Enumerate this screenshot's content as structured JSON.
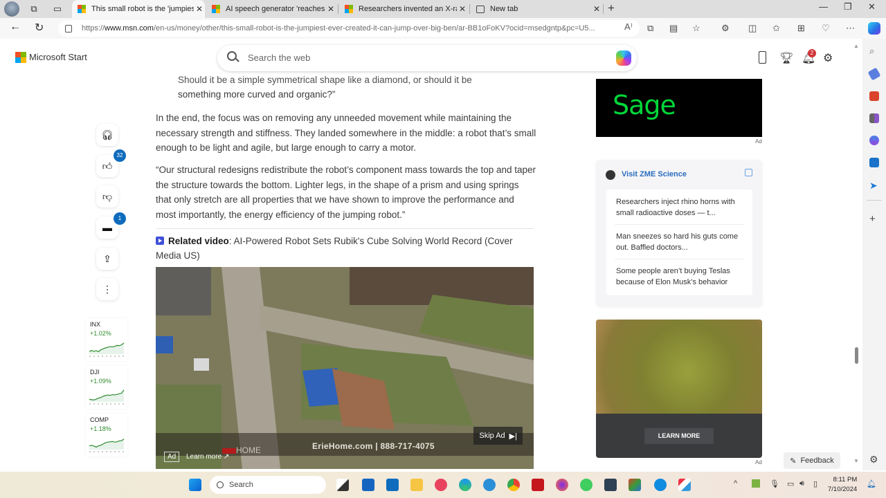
{
  "browser": {
    "tabs": [
      {
        "title": "This small robot is the 'jumpiest'",
        "active": true
      },
      {
        "title": "AI speech generator 'reaches hu",
        "active": false
      },
      {
        "title": "Researchers invented an X-ray vi",
        "active": false
      },
      {
        "title": "New tab",
        "active": false
      }
    ],
    "url_prefix": "https://",
    "url_host": "www.msn.com",
    "url_path": "/en-us/money/other/this-small-robot-is-the-jumpiest-ever-created-it-can-jump-over-big-ben/ar-BB1oFoKV?ocid=msedgntp&pc=U5...",
    "read_aloud_icon": "A⁾"
  },
  "msn": {
    "brand": "Microsoft Start",
    "search_placeholder": "Search the web",
    "notification_count": "2"
  },
  "rail": {
    "like_count": "32",
    "comment_count": "1"
  },
  "tickers": [
    {
      "symbol": "INX",
      "change": "+1.02%",
      "trend": [
        0.2,
        0.3,
        0.22,
        0.28,
        0.2,
        0.35,
        0.42,
        0.5,
        0.55,
        0.6,
        0.58,
        0.62,
        0.7,
        0.68,
        0.75,
        0.9
      ]
    },
    {
      "symbol": "DJI",
      "change": "+1.09%",
      "trend": [
        0.2,
        0.18,
        0.15,
        0.22,
        0.3,
        0.35,
        0.45,
        0.5,
        0.55,
        0.52,
        0.58,
        0.56,
        0.6,
        0.65,
        0.7,
        0.95
      ]
    },
    {
      "symbol": "COMP",
      "change": "+1.18%",
      "trend": [
        0.3,
        0.35,
        0.28,
        0.2,
        0.3,
        0.35,
        0.45,
        0.55,
        0.6,
        0.62,
        0.65,
        0.6,
        0.62,
        0.7,
        0.72,
        0.85
      ]
    }
  ],
  "article": {
    "quote_line1": "Should it be a simple symmetrical shape like a diamond, or should it be",
    "quote_line2": "something more curved and organic?”",
    "para1": "In the end, the focus was on removing any unneeded movement while maintaining the necessary strength and stiffness. They landed somewhere in the middle: a robot that’s small enough to be light and agile, but large enough to carry a motor.",
    "para2": "“Our structural redesigns redistribute the robot’s component mass towards the top and taper the structure towards the bottom. Lighter legs, in the shape of a prism and using springs that only stretch are all properties that we have shown to improve the performance and most importantly, the energy efficiency of the jumping robot.”",
    "related_label": "Related video",
    "related_title": ": AI-Powered Robot Sets Rubik's Cube Solving World Record (Cover Media US)"
  },
  "video_ad": {
    "skip_label": "Skip Ad",
    "ad_badge": "Ad",
    "learn_more": "Learn more",
    "sponsor_text": "ErieHome.com | 888-717-4075",
    "logo_text": "HOME"
  },
  "right": {
    "sage_logo": "Sage",
    "ad_label": "Ad",
    "zme_title": "Visit ZME Science",
    "zme_items": [
      "Researchers inject rhino horns with small radioactive doses — t...",
      "Man sneezes so hard his guts come out. Baffled doctors...",
      "Some people aren’t buying Teslas because of Elon Musk’s behavior"
    ],
    "ad2_button": "LEARN MORE",
    "feedback": "Feedback"
  },
  "taskbar": {
    "search_label": "Search",
    "time": "8:11 PM",
    "date": "7/10/2024"
  },
  "colors": {
    "accent": "#0f6cbd",
    "link": "#2a6cc0",
    "positive": "#2e8b2e",
    "sage_green": "#00d639"
  }
}
